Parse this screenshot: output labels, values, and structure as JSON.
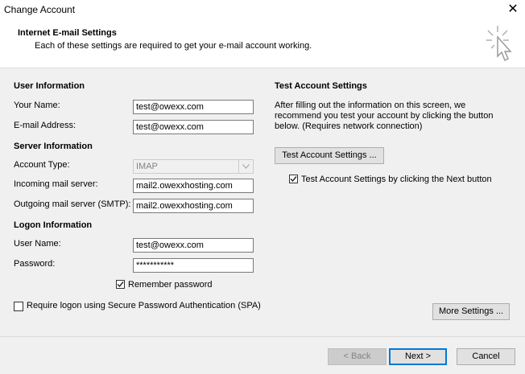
{
  "window": {
    "title": "Change Account",
    "close_glyph": "✕"
  },
  "header": {
    "title": "Internet E-mail Settings",
    "subtitle": "Each of these settings are required to get your e-mail account working.",
    "icon": "wizard-cursor-icon"
  },
  "user_info": {
    "heading": "User Information",
    "name_label": "Your Name:",
    "name_value": "test@owexx.com",
    "email_label": "E-mail Address:",
    "email_value": "test@owexx.com"
  },
  "server_info": {
    "heading": "Server Information",
    "account_type_label": "Account Type:",
    "account_type_value": "IMAP",
    "incoming_label": "Incoming mail server:",
    "incoming_value": "mail2.owexxhosting.com",
    "outgoing_label": "Outgoing mail server (SMTP):",
    "outgoing_value": "mail2.owexxhosting.com"
  },
  "logon_info": {
    "heading": "Logon Information",
    "username_label": "User Name:",
    "username_value": "test@owexx.com",
    "password_label": "Password:",
    "password_value": "***********",
    "remember_label": "Remember password",
    "remember_checked": true,
    "spa_label": "Require logon using Secure Password Authentication (SPA)",
    "spa_checked": false
  },
  "test_settings": {
    "heading": "Test Account Settings",
    "line1": "After filling out the information on this screen, we",
    "line2": "recommend you test your account by clicking the button",
    "line3": "below. (Requires network connection)",
    "test_button": "Test Account Settings ...",
    "auto_test_label": "Test Account Settings by clicking the Next button",
    "auto_test_checked": true
  },
  "buttons": {
    "more_settings": "More Settings ...",
    "back": "< Back",
    "next": "Next >",
    "cancel": "Cancel"
  }
}
